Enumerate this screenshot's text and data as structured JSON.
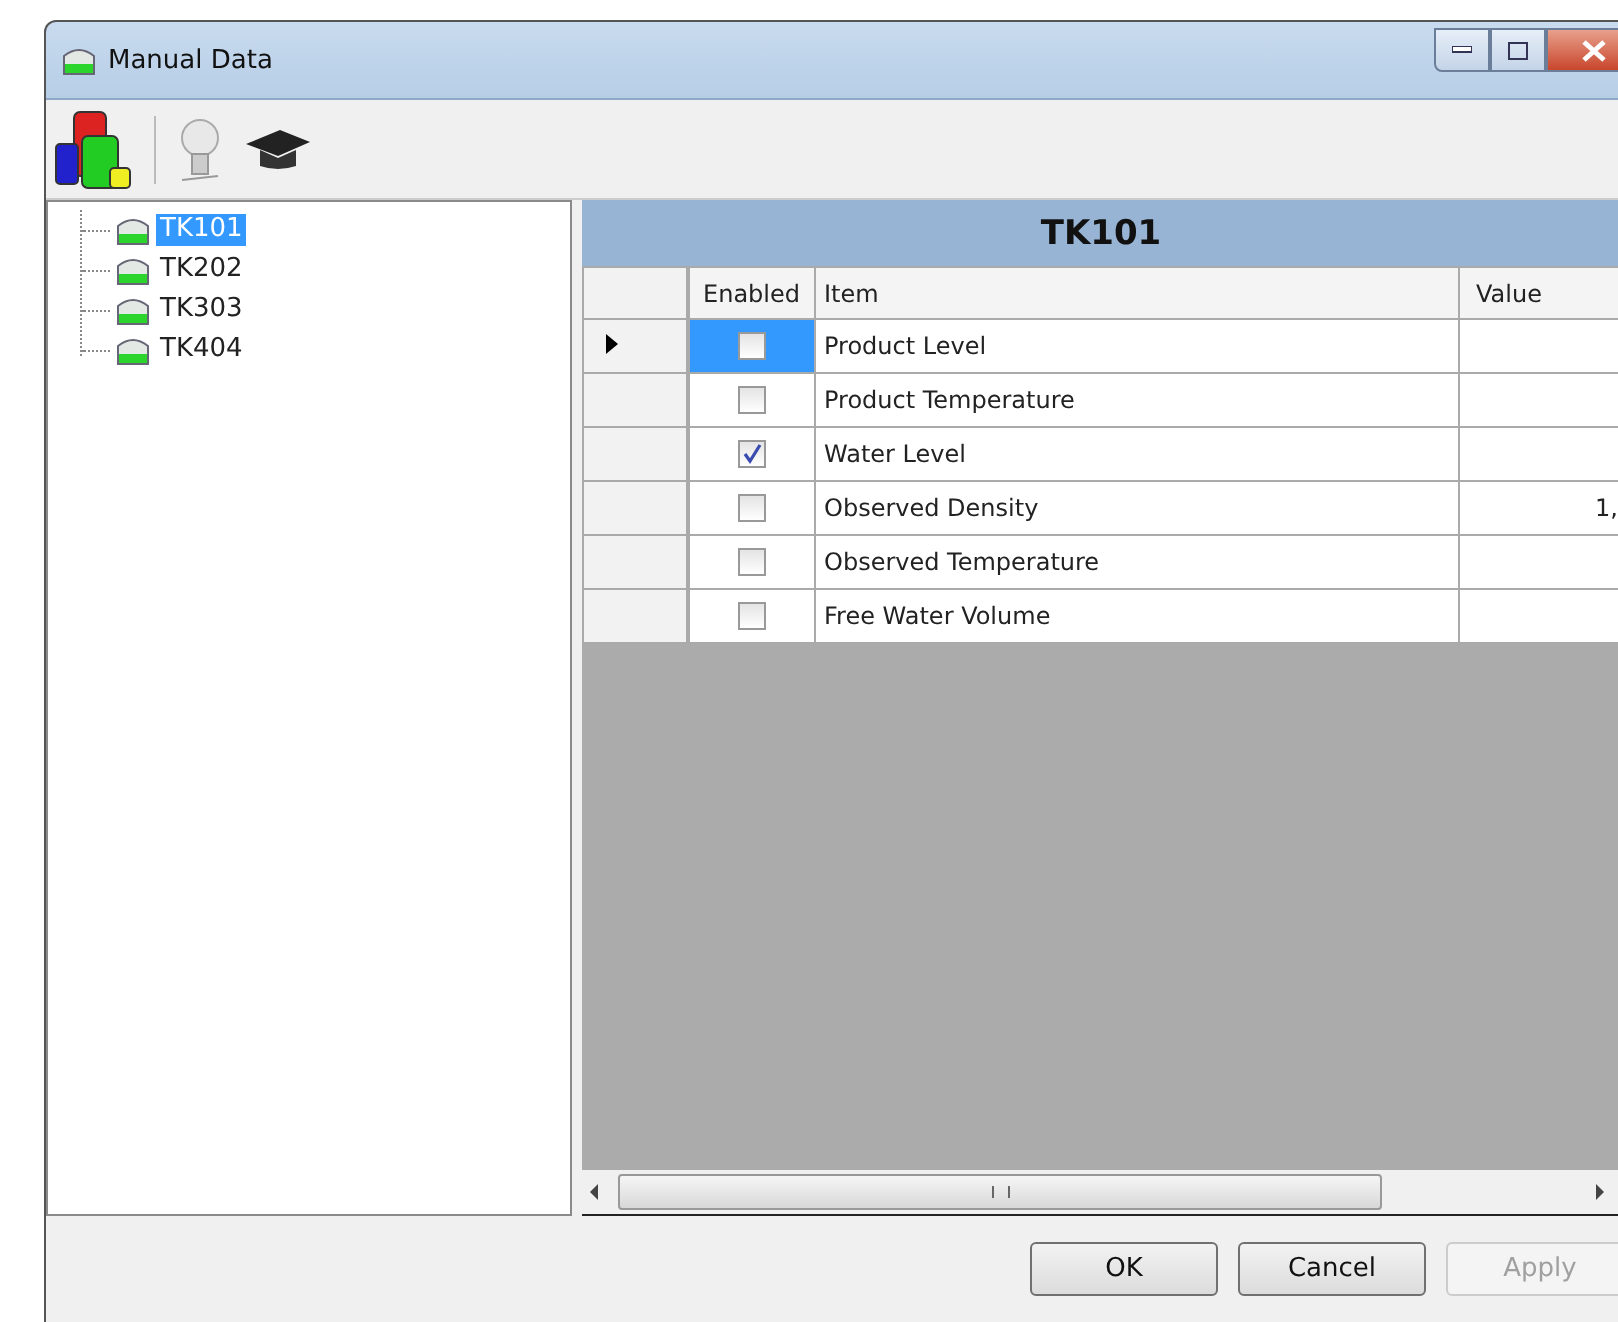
{
  "window": {
    "title": "Manual Data"
  },
  "tree": {
    "items": [
      {
        "label": "TK101",
        "selected": true
      },
      {
        "label": "TK202",
        "selected": false
      },
      {
        "label": "TK303",
        "selected": false
      },
      {
        "label": "TK404",
        "selected": false
      }
    ]
  },
  "grid": {
    "title": "TK101",
    "columns": [
      "Enabled",
      "Item",
      "Value"
    ],
    "rows": [
      {
        "item": "Product Level",
        "enabled": false,
        "selected": true
      },
      {
        "item": "Product Temperature",
        "enabled": false,
        "selected": false
      },
      {
        "item": "Water Level",
        "enabled": true,
        "selected": false
      },
      {
        "item": "Observed Density",
        "enabled": false,
        "selected": false,
        "value": "1,"
      },
      {
        "item": "Observed Temperature",
        "enabled": false,
        "selected": false
      },
      {
        "item": "Free Water Volume",
        "enabled": false,
        "selected": false
      }
    ]
  },
  "buttons": [
    {
      "label": "OK",
      "disabled": false
    },
    {
      "label": "Cancel",
      "disabled": false
    },
    {
      "label": "Apply",
      "disabled": true
    }
  ]
}
